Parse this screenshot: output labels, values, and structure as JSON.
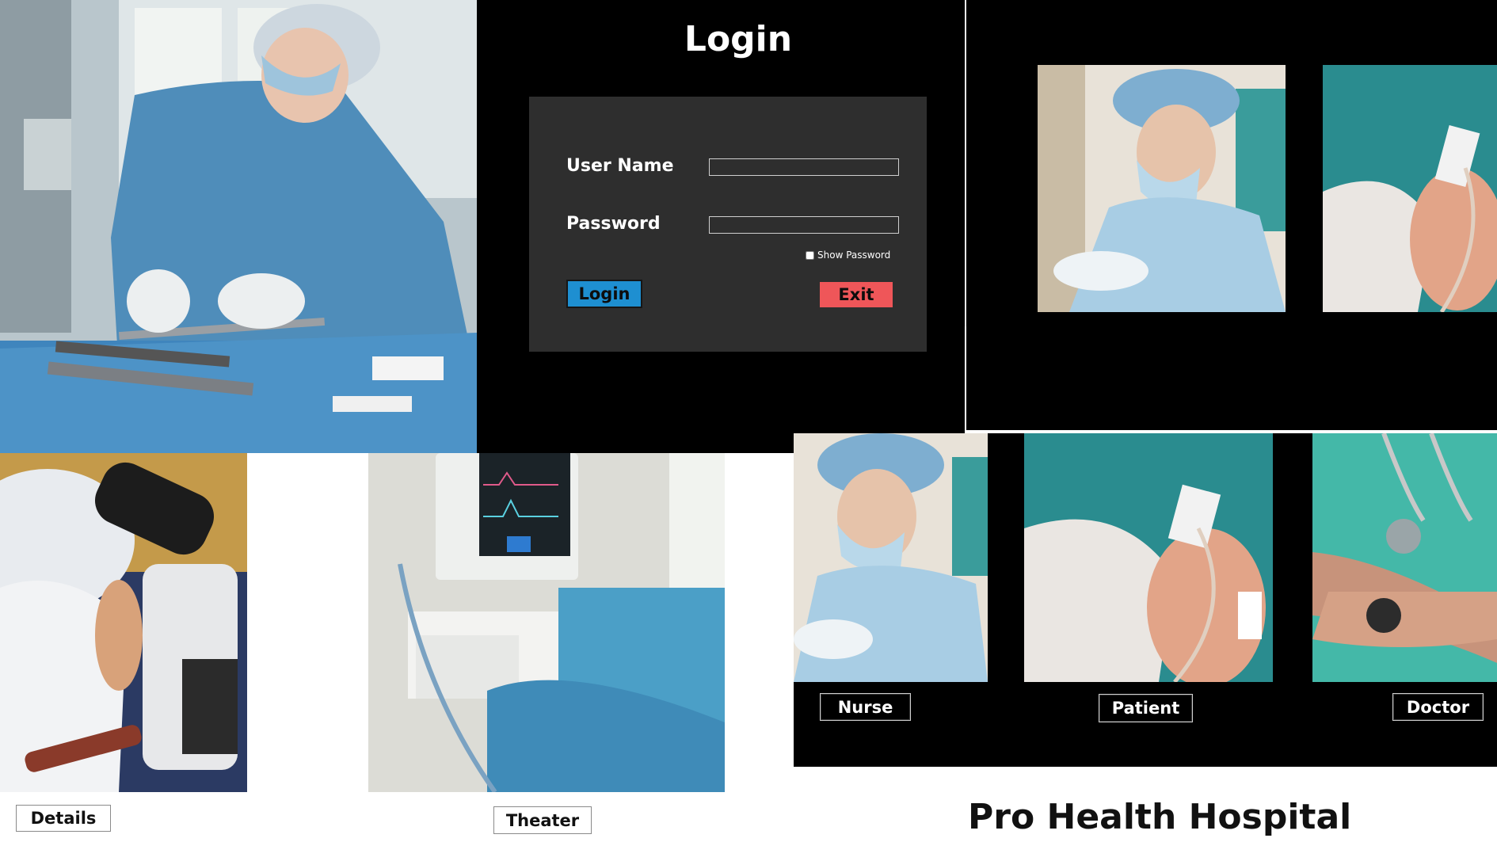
{
  "login": {
    "title": "Login",
    "username_label": "User Name",
    "password_label": "Password",
    "username_value": "",
    "password_value": "",
    "show_password_label": "Show Password",
    "login_button": "Login",
    "exit_button": "Exit"
  },
  "tiles": {
    "details": "Details",
    "theater": "Theater",
    "nurse": "Nurse",
    "patient": "Patient",
    "doctor": "Doctor"
  },
  "hospital_name": "Pro Health Hospital",
  "colors": {
    "login_button": "#1e8fd1",
    "exit_button": "#ef5659",
    "login_panel": "#2e2e2e",
    "scrubs": "#5a9cc6"
  }
}
